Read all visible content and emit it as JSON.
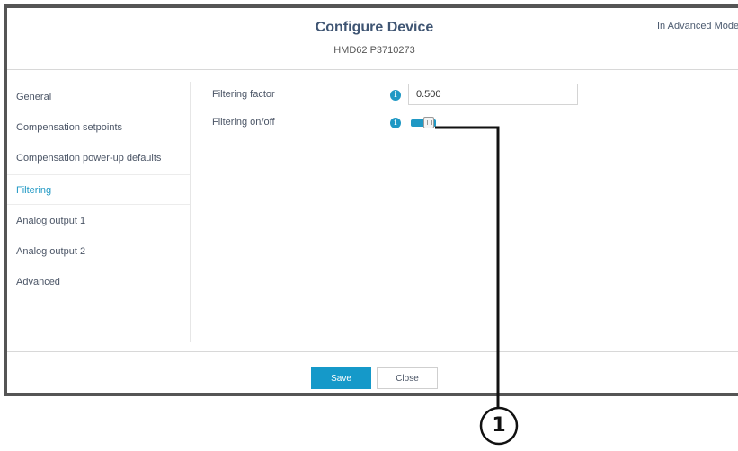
{
  "header": {
    "title": "Configure Device",
    "subtitle": "HMD62 P3710273",
    "mode": "In Advanced Mode"
  },
  "nav": {
    "items": [
      {
        "label": "General",
        "active": false
      },
      {
        "label": "Compensation setpoints",
        "active": false
      },
      {
        "label": "Compensation power-up defaults",
        "active": false
      },
      {
        "label": "Filtering",
        "active": true
      },
      {
        "label": "Analog output 1",
        "active": false
      },
      {
        "label": "Analog output 2",
        "active": false
      },
      {
        "label": "Advanced",
        "active": false
      }
    ]
  },
  "content": {
    "filtering_factor": {
      "label": "Filtering factor",
      "value": "0.500",
      "icon": "info-icon"
    },
    "filtering_onoff": {
      "label": "Filtering on/off",
      "state": "on",
      "icon": "info-icon"
    }
  },
  "footer": {
    "save_label": "Save",
    "close_label": "Close"
  },
  "callout": {
    "number": "1"
  },
  "colors": {
    "accent": "#1f98c4",
    "title": "#3f5573",
    "frame": "#555555"
  }
}
